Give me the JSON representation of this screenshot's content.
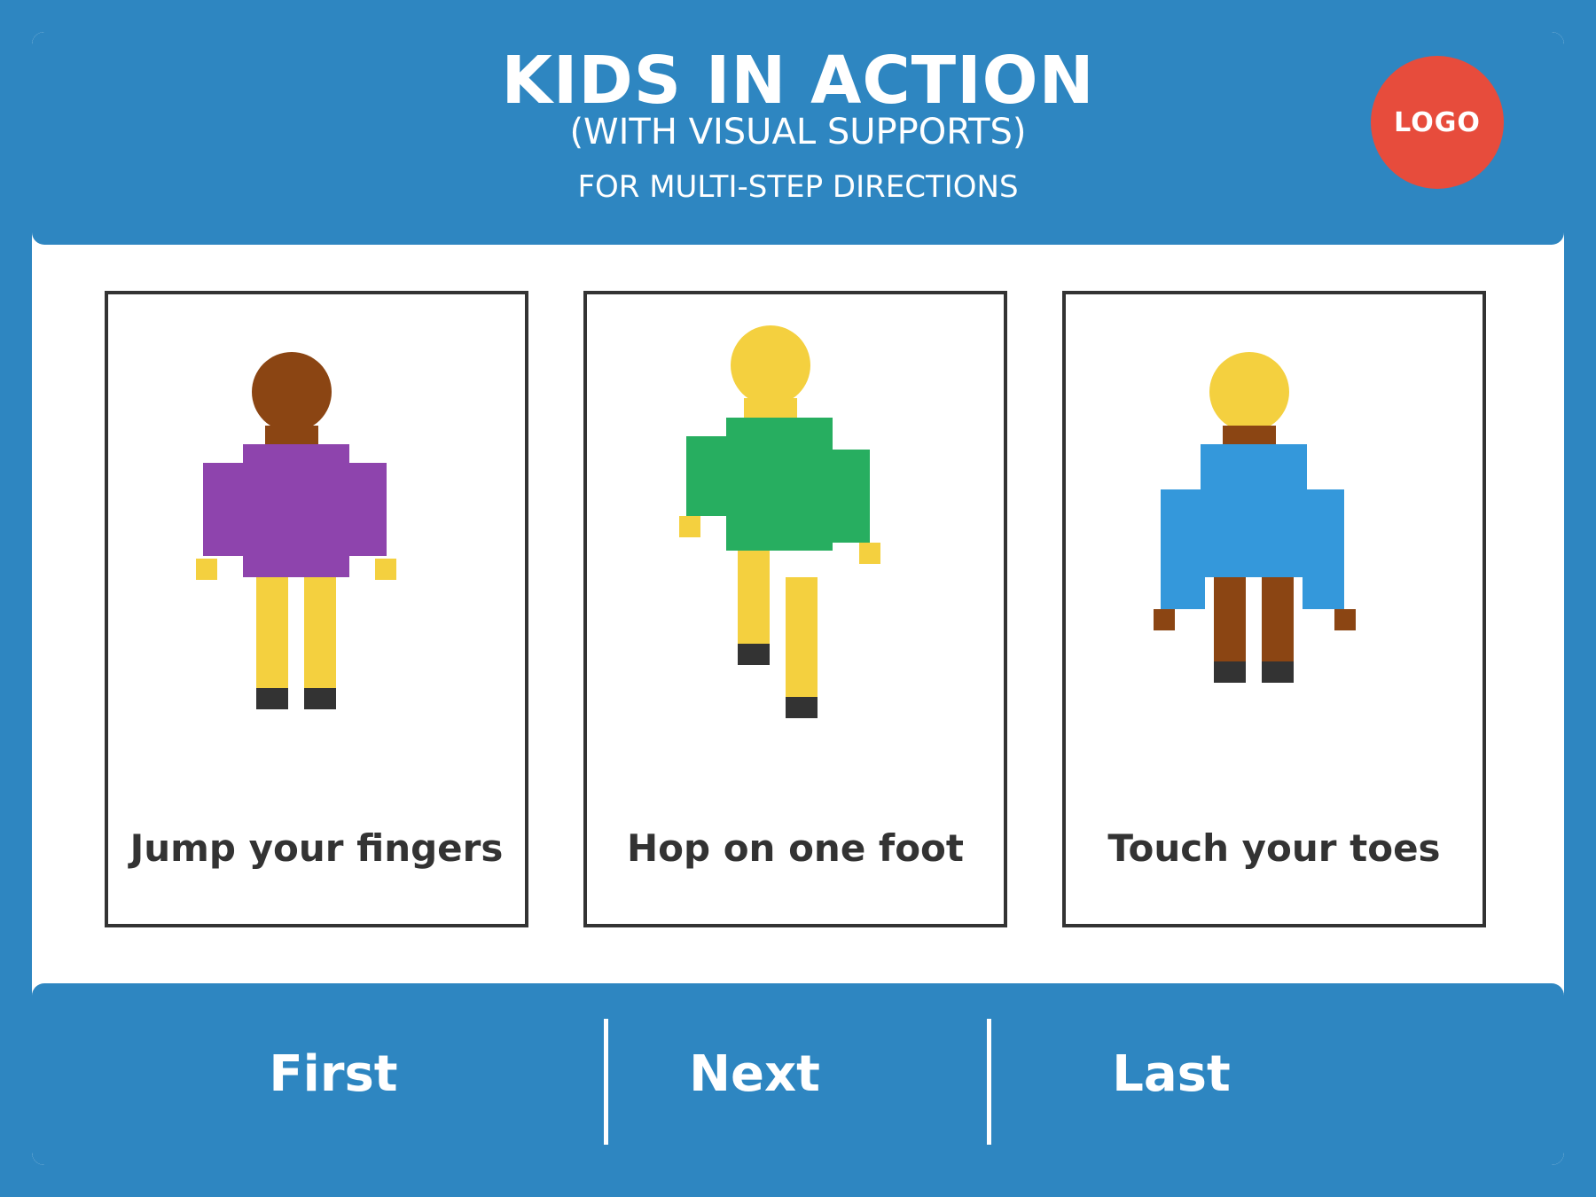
{
  "header": {
    "title": "KIDS IN ACTION",
    "subtitle": "(WITH VISUAL SUPPORTS)",
    "tagline": "FOR MULTI-STEP DIRECTIONS",
    "logo": "LOGO"
  },
  "cards": [
    {
      "label": "Jump your fingers",
      "figure": "kid-arms-down",
      "hair": "#8b4513",
      "shirt": "#8e44ad",
      "legs": "#f4d03f",
      "skin": "#f4d03f"
    },
    {
      "label": "Hop on one foot",
      "figure": "kid-hopping",
      "hair": "#f4d03f",
      "shirt": "#27ae60",
      "legs": "#f4d03f",
      "skin": "#f4d03f"
    },
    {
      "label": "Touch your toes",
      "figure": "kid-reaching-down",
      "hair": "#f4d03f",
      "shirt": "#3498db",
      "legs": "#8b4513",
      "skin": "#8b4513"
    }
  ],
  "nav": {
    "first": "First",
    "next": "Next",
    "last": "Last"
  },
  "colors": {
    "background": "#2e86c1",
    "logo": "#e74c3c",
    "shoes": "#333333",
    "text": "#333333"
  }
}
